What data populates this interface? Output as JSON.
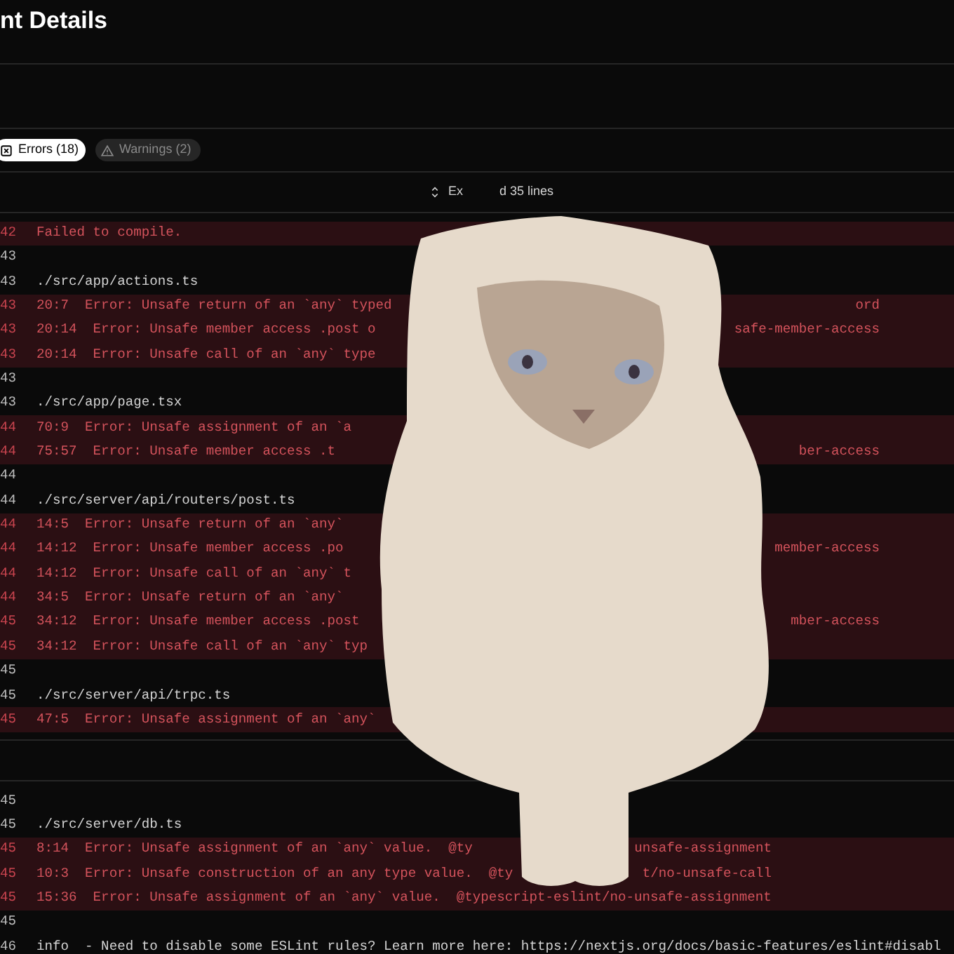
{
  "title": "nt Details",
  "tabs": [
    {
      "label": "Errors (18)",
      "selected": true,
      "kind": "error"
    },
    {
      "label": "Warnings (2)",
      "selected": false,
      "kind": "warning"
    }
  ],
  "log": [
    {
      "kind": "expand",
      "fragments": [
        "Ex",
        "d 35 lines"
      ]
    },
    {
      "kind": "lines",
      "lines": [
        {
          "number": "42",
          "kind": "error",
          "text": "Failed to compile."
        },
        {
          "number": "43",
          "kind": "plain"
        },
        {
          "number": "43",
          "kind": "plain",
          "text": "./src/app/actions.ts"
        },
        {
          "number": "43",
          "kind": "error",
          "text": "20:7  Error: Unsafe return of an `any` typed",
          "tail": "ord"
        },
        {
          "number": "43",
          "kind": "error",
          "text": "20:14  Error: Unsafe member access .post o",
          "tail": "safe-member-access"
        },
        {
          "number": "43",
          "kind": "error",
          "text": "20:14  Error: Unsafe call of an `any` type"
        },
        {
          "number": "43",
          "kind": "plain"
        },
        {
          "number": "43",
          "kind": "plain",
          "text": "./src/app/page.tsx"
        },
        {
          "number": "44",
          "kind": "error",
          "text": "70:9  Error: Unsafe assignment of an `a"
        },
        {
          "number": "44",
          "kind": "error",
          "text": "75:57  Error: Unsafe member access .t",
          "tail": "ber-access"
        },
        {
          "number": "44",
          "kind": "plain"
        },
        {
          "number": "44",
          "kind": "plain",
          "text": "./src/server/api/routers/post.ts"
        },
        {
          "number": "44",
          "kind": "error",
          "text": "14:5  Error: Unsafe return of an `any`"
        },
        {
          "number": "44",
          "kind": "error",
          "text": "14:12  Error: Unsafe member access .po",
          "tail": "member-access"
        },
        {
          "number": "44",
          "kind": "error",
          "text": "14:12  Error: Unsafe call of an `any` t"
        },
        {
          "number": "44",
          "kind": "error",
          "text": "34:5  Error: Unsafe return of an `any`"
        },
        {
          "number": "45",
          "kind": "error",
          "text": "34:12  Error: Unsafe member access .post",
          "tail": "mber-access"
        },
        {
          "number": "45",
          "kind": "error",
          "text": "34:12  Error: Unsafe call of an `any` typ"
        },
        {
          "number": "45",
          "kind": "plain"
        },
        {
          "number": "45",
          "kind": "plain",
          "text": "./src/server/api/trpc.ts"
        },
        {
          "number": "45",
          "kind": "error",
          "text": "47:5  Error: Unsafe assignment of an `any`"
        }
      ]
    },
    {
      "kind": "expand"
    },
    {
      "kind": "lines",
      "lines": [
        {
          "number": "45",
          "kind": "plain"
        },
        {
          "number": "45",
          "kind": "plain",
          "text": "./src/server/db.ts"
        },
        {
          "number": "45",
          "kind": "error",
          "text": "8:14  Error: Unsafe assignment of an `any` value.  @ty",
          "tail": "unsafe-assignment"
        },
        {
          "number": "45",
          "kind": "error",
          "text": "10:3  Error: Unsafe construction of an any type value.  @ty",
          "tail": "t/no-unsafe-call"
        },
        {
          "number": "45",
          "kind": "error",
          "text": "15:36  Error: Unsafe assignment of an `any` value.  @typescript-eslint/no-unsafe-assignment"
        },
        {
          "number": "45",
          "kind": "plain"
        },
        {
          "number": "46",
          "kind": "plain",
          "text": "info  - Need to disable some ESLint rules? Learn more here: https://nextjs.org/docs/basic-features/eslint#disabl"
        }
      ]
    }
  ]
}
